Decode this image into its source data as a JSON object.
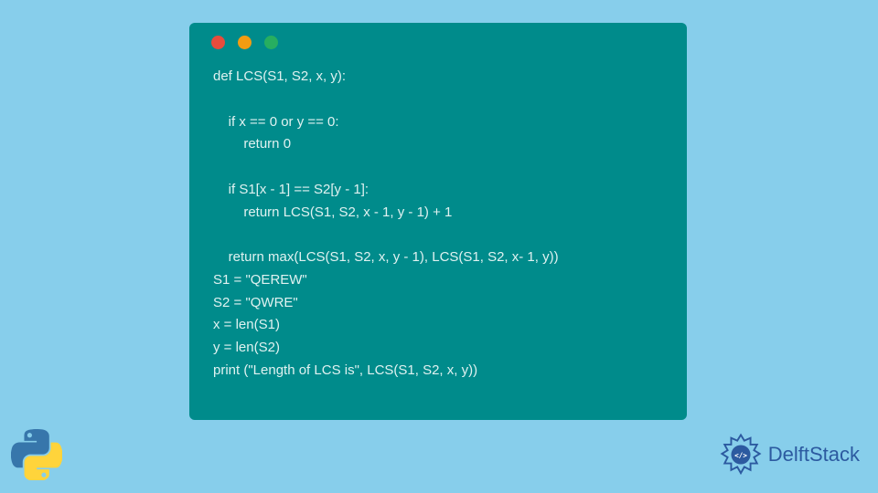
{
  "code": {
    "line1": "def LCS(S1, S2, x, y):",
    "line2": "",
    "line3": "    if x == 0 or y == 0:",
    "line4": "        return 0",
    "line5": "",
    "line6": "    if S1[x - 1] == S2[y - 1]:",
    "line7": "        return LCS(S1, S2, x - 1, y - 1) + 1",
    "line8": "",
    "line9": "    return max(LCS(S1, S2, x, y - 1), LCS(S1, S2, x- 1, y))",
    "line10": "S1 = \"QEREW\"",
    "line11": "S2 = \"QWRE\"",
    "line12": "x = len(S1)",
    "line13": "y = len(S2)",
    "line14": "print (\"Length of LCS is\", LCS(S1, S2, x, y))"
  },
  "brand": {
    "name": "DelftStack"
  }
}
